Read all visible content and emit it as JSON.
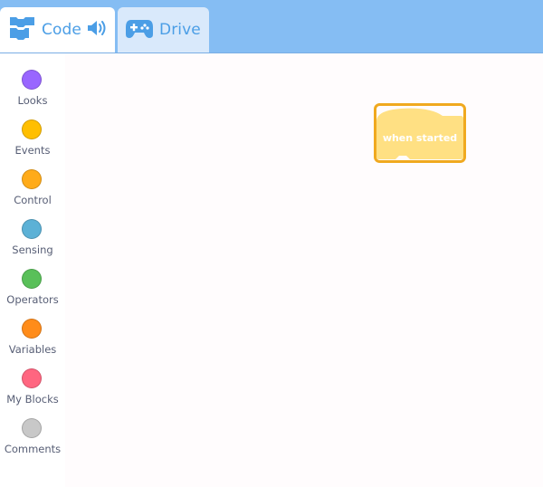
{
  "tabs": {
    "code": {
      "label": "Code",
      "icon": "code-blocks-icon"
    },
    "drive": {
      "label": "Drive",
      "icon": "gamepad-icon"
    }
  },
  "categories": [
    {
      "label": "Looks",
      "color": "#9966ff"
    },
    {
      "label": "Events",
      "color": "#ffbf00"
    },
    {
      "label": "Control",
      "color": "#ffab19"
    },
    {
      "label": "Sensing",
      "color": "#5cb1d6"
    },
    {
      "label": "Operators",
      "color": "#59c059"
    },
    {
      "label": "Variables",
      "color": "#ff8c1a"
    },
    {
      "label": "My Blocks",
      "color": "#ff6680"
    },
    {
      "label": "Comments",
      "color": "#c8c8c8"
    }
  ],
  "workspace": {
    "block": {
      "label": "when started",
      "fill": "#ffe083",
      "outline": "#f0a91f"
    }
  },
  "colors": {
    "tabbar": "#85bdf3",
    "accent": "#4b9ee6"
  }
}
